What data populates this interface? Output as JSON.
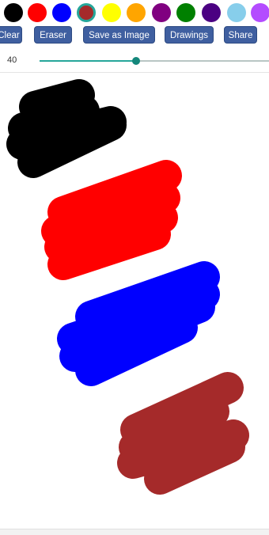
{
  "palette": {
    "colors": [
      {
        "name": "black",
        "hex": "#000000"
      },
      {
        "name": "red",
        "hex": "#ff0000"
      },
      {
        "name": "blue",
        "hex": "#0000ff"
      },
      {
        "name": "brown",
        "hex": "#a52a2a",
        "selected": true
      },
      {
        "name": "yellow",
        "hex": "#ffff00"
      },
      {
        "name": "orange",
        "hex": "#ffa500"
      },
      {
        "name": "purple",
        "hex": "#800080"
      },
      {
        "name": "green",
        "hex": "#008000"
      },
      {
        "name": "indigo",
        "hex": "#4b0082"
      },
      {
        "name": "sky-blue",
        "hex": "#87ceeb"
      },
      {
        "name": "violet",
        "hex": "#b44cff"
      }
    ],
    "selected_ring_color": "#26a69a"
  },
  "toolbar": {
    "clear_label": "Clear",
    "eraser_label": "Eraser",
    "save_image_label": "Save as Image",
    "drawings_label": "Drawings",
    "share_label": "Share",
    "button_color": "#3f5fa0"
  },
  "brush": {
    "size_value": "40",
    "slider_fraction": 0.42,
    "accent_color": "#26a69a"
  },
  "canvas": {
    "background": "#ffffff",
    "strokes": [
      {
        "name": "black-stroke",
        "color": "#000000"
      },
      {
        "name": "red-stroke",
        "color": "#ff0000"
      },
      {
        "name": "blue-stroke",
        "color": "#0000ff"
      },
      {
        "name": "brown-stroke",
        "color": "#a52a2a"
      }
    ]
  }
}
